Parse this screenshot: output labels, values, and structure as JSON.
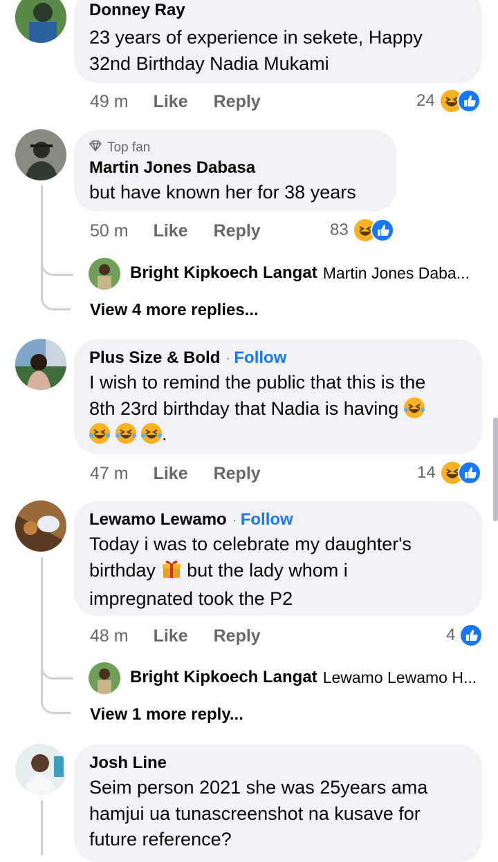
{
  "comments": [
    {
      "name": "Donney Ray",
      "text": "23 years of experience in sekete, Happy 32nd Birthday Nadia Mukami",
      "time": "49 m",
      "like_label": "Like",
      "reply_label": "Reply",
      "reaction_count": "24"
    },
    {
      "badge": "Top fan",
      "name": "Martin Jones Dabasa",
      "text": "but have known her for 38 years",
      "time": "50 m",
      "like_label": "Like",
      "reply_label": "Reply",
      "reaction_count": "83",
      "reply_preview": {
        "name": "Bright Kipkoech Langat",
        "text": "Martin Jones Daba..."
      },
      "view_more": "View 4 more replies..."
    },
    {
      "name": "Plus Size & Bold",
      "follow_label": "Follow",
      "text_line1": "I wish to remind the public that this is the",
      "text_line2": "8th 23rd birthday that Nadia is having",
      "text_end": ".",
      "time": "47 m",
      "like_label": "Like",
      "reply_label": "Reply",
      "reaction_count": "14"
    },
    {
      "name": "Lewamo Lewamo",
      "follow_label": "Follow",
      "text_line1": "Today i was to celebrate my daughter's",
      "text_line2a": "birthday",
      "text_line2b": "but the lady whom i",
      "text_line3": "impregnated took the P2",
      "time": "48 m",
      "like_label": "Like",
      "reply_label": "Reply",
      "reaction_count": "4",
      "reply_preview": {
        "name": "Bright Kipkoech Langat",
        "text": "Lewamo Lewamo H..."
      },
      "view_more": "View 1 more reply..."
    },
    {
      "name": "Josh Line",
      "text": "Seim person 2021 she was 25years ama hamjui ua tunascreenshot na kusave for future reference?"
    }
  ],
  "colors": {
    "accent": "#1877f2",
    "bubble": "#f0f2f5",
    "secondary_text": "#65676b",
    "haha": "#f7b125"
  }
}
